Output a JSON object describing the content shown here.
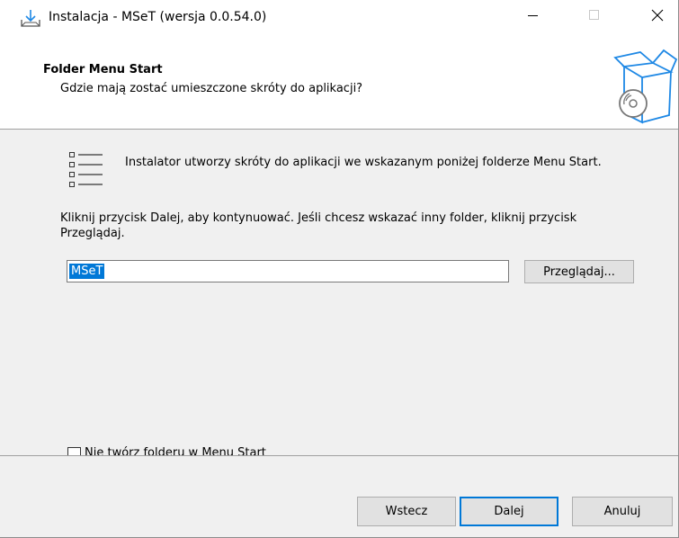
{
  "window": {
    "title": "Instalacja - MSeT (wersja 0.0.54.0)",
    "icons": {
      "app": "installer-download-icon",
      "minimize": "minimize-icon",
      "maximize": "maximize-icon",
      "close": "close-icon"
    }
  },
  "header": {
    "title": "Folder Menu Start",
    "subtitle": "Gdzie mają zostać umieszczone skróty do aplikacji?",
    "image": "software-box-disc-icon"
  },
  "content": {
    "icon": "start-menu-list-icon",
    "intro": "Instalator utworzy skróty do aplikacji we wskazanym poniżej folderze Menu Start.",
    "instruction": "Kliknij przycisk Dalej, aby kontynuować. Jeśli chcesz wskazać inny folder, kliknij przycisk Przeglądaj.",
    "folder_value": "MSeT",
    "browse_label": "Przeglądaj...",
    "no_folder_label": "Nie twórz folderu w Menu Start",
    "no_folder_checked": false
  },
  "footer": {
    "back_label": "Wstecz",
    "next_label": "Dalej",
    "cancel_label": "Anuluj"
  },
  "colors": {
    "accent": "#0078d7",
    "panel": "#f0f0f0",
    "icon_blue": "#1e88e5"
  }
}
